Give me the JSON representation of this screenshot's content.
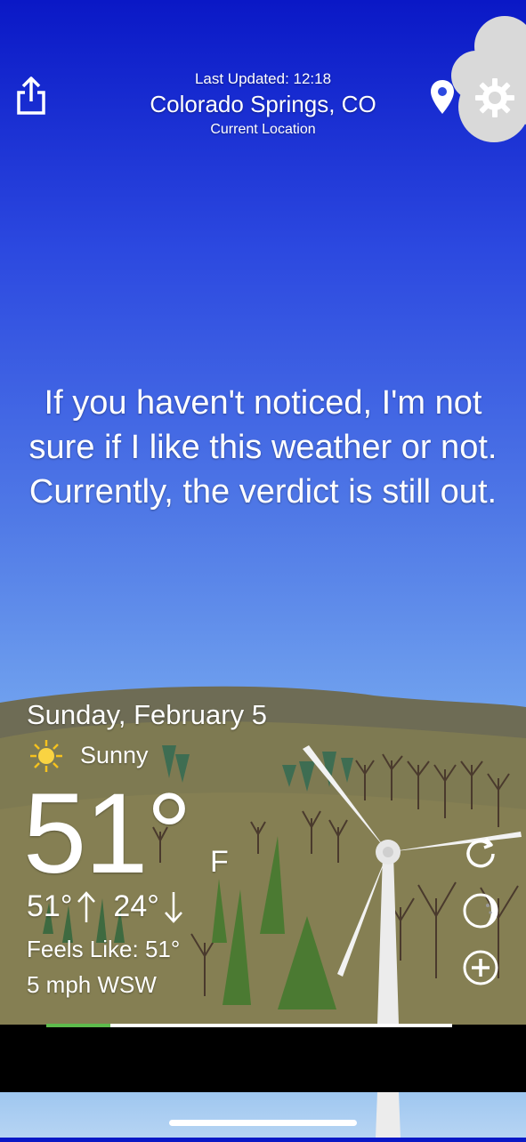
{
  "header": {
    "last_updated": "Last Updated: 12:18",
    "city": "Colorado Springs, CO",
    "location_label": "Current Location"
  },
  "quote": "If you haven't noticed, I'm not sure if I like this weather or not. Currently, the verdict is still out.",
  "weather": {
    "date": "Sunday, February 5",
    "condition": "Sunny",
    "condition_icon": "sun-icon",
    "temperature": "51°",
    "unit": "F",
    "high": "51°",
    "low": "24°",
    "feels_like": "Feels Like: 51°",
    "wind": "5 mph WSW"
  },
  "actions": {
    "refresh_icon": "refresh-icon",
    "moon_icon": "moon-phase-icon",
    "add_icon": "add-icon",
    "share_icon": "share-icon",
    "pin_icon": "location-pin-icon",
    "gear_icon": "gear-icon"
  },
  "colors": {
    "sky_top": "#0a18c6",
    "sky_bottom": "#87b6f0",
    "hill": "#7d7a52",
    "tree_green": "#3c7a36",
    "progress_fill": "#5dbb4c"
  }
}
